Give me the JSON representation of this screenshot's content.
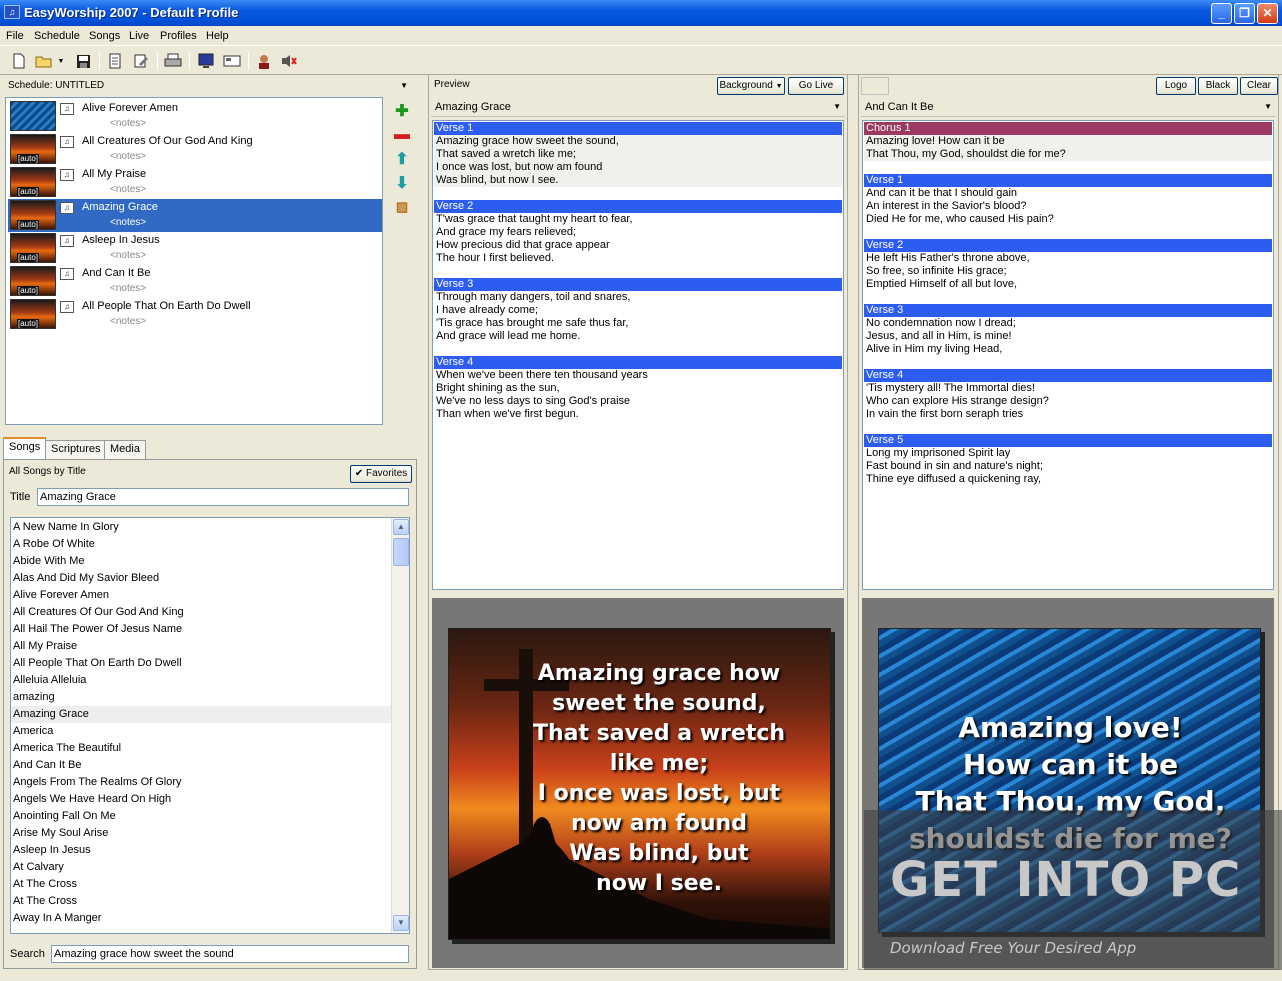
{
  "window": {
    "title": "EasyWorship 2007 - Default Profile",
    "minimize": "_",
    "maximize": "❐",
    "close": "✕"
  },
  "menu": [
    "File",
    "Schedule",
    "Songs",
    "Live",
    "Profiles",
    "Help"
  ],
  "toolbar_icons": [
    "new-icon",
    "open-icon",
    "save-icon",
    "properties-icon",
    "edit-icon",
    "print-icon",
    "monitor-icon",
    "display-icon",
    "user-icon",
    "mute-icon"
  ],
  "schedule": {
    "label": "Schedule: UNTITLED",
    "items": [
      {
        "title": "Alive Forever Amen",
        "notes": "<notes>",
        "thumb": "blue",
        "auto": ""
      },
      {
        "title": "All Creatures Of Our God And King",
        "notes": "<notes>",
        "thumb": "auto",
        "auto": "[auto]"
      },
      {
        "title": "All My Praise",
        "notes": "<notes>",
        "thumb": "auto",
        "auto": "[auto]"
      },
      {
        "title": "Amazing Grace",
        "notes": "<notes>",
        "thumb": "auto",
        "auto": "[auto]",
        "selected": true
      },
      {
        "title": "Asleep In Jesus",
        "notes": "<notes>",
        "thumb": "auto",
        "auto": "[auto]"
      },
      {
        "title": "And Can It Be",
        "notes": "<notes>",
        "thumb": "auto",
        "auto": "[auto]"
      },
      {
        "title": "All People That On Earth Do Dwell",
        "notes": "<notes>",
        "thumb": "auto",
        "auto": "[auto]"
      }
    ]
  },
  "tabs": [
    "Songs",
    "Scriptures",
    "Media"
  ],
  "songs": {
    "header": "All Songs by Title",
    "favorites": "Favorites",
    "title_label": "Title",
    "title_value": "Amazing Grace",
    "list": [
      "A New Name In Glory",
      "A Robe Of White",
      "Abide With Me",
      "Alas And Did My Savior Bleed",
      "Alive Forever Amen",
      "All Creatures Of Our God And King",
      "All Hail The Power Of Jesus Name",
      "All My Praise",
      "All People That On Earth Do Dwell",
      "Alleluia Alleluia",
      "amazing",
      "Amazing Grace",
      "America",
      "America The Beautiful",
      "And Can It Be",
      "Angels From The Realms Of Glory",
      "Angels We Have Heard On High",
      "Anointing Fall On Me",
      "Arise My Soul Arise",
      "Asleep In Jesus",
      "At Calvary",
      "At The Cross",
      "At The Cross",
      "Away In A Manger"
    ],
    "selected_index": 11,
    "search_label": "Search",
    "search_value": "Amazing grace how sweet the sound"
  },
  "preview": {
    "label": "Preview",
    "background_btn": "Background",
    "golive_btn": "Go Live >>>",
    "song": "Amazing Grace",
    "verses": [
      {
        "name": "Verse 1",
        "lines": [
          "Amazing grace how sweet the sound,",
          "That saved a wretch like me;",
          "I once was lost, but now am found",
          "Was blind, but now I see."
        ]
      },
      {
        "name": "Verse 2",
        "lines": [
          "T'was grace that taught my heart to fear,",
          "And grace my fears relieved;",
          "How precious did that grace appear",
          "The hour I first believed."
        ]
      },
      {
        "name": "Verse 3",
        "lines": [
          "Through many dangers, toil and snares,",
          "I have already come;",
          "'Tis grace has brought me safe thus far,",
          "And grace will lead me home."
        ]
      },
      {
        "name": "Verse 4",
        "lines": [
          "When we've been there ten thousand years",
          "Bright shining as the sun,",
          "We've no less days to sing God's praise",
          "Than when we've first begun."
        ]
      }
    ],
    "slide_lines": [
      "Amazing grace how",
      "sweet the sound,",
      "That saved a wretch",
      "like me;",
      "I once was lost, but",
      "now am found",
      "Was blind, but",
      "now I see."
    ]
  },
  "live": {
    "logo_btn": "Logo",
    "black_btn": "Black",
    "clear_btn": "Clear",
    "song": "And Can It Be",
    "verses": [
      {
        "name": "Chorus 1",
        "chorus": true,
        "lines": [
          "Amazing love! How can it be",
          "That Thou, my God, shouldst die for me?"
        ]
      },
      {
        "name": "Verse 1",
        "lines": [
          "And can it be that I should gain",
          "An interest in the Savior's blood?",
          "Died He for me, who caused His pain?"
        ]
      },
      {
        "name": "Verse 2",
        "lines": [
          "He left His Father's throne above,",
          "So free, so infinite His grace;",
          "Emptied Himself of all but love,"
        ]
      },
      {
        "name": "Verse 3",
        "lines": [
          "No condemnation now I dread;",
          "Jesus, and all in Him, is mine!",
          "Alive in Him my living Head,"
        ]
      },
      {
        "name": "Verse 4",
        "lines": [
          "'Tis mystery all! The Immortal dies!",
          "Who can explore His strange design?",
          "In vain the first born seraph tries"
        ]
      },
      {
        "name": "Verse 5",
        "lines": [
          "Long my imprisoned Spirit lay",
          "Fast bound in sin and nature's night;",
          "Thine eye diffused a quickening ray,"
        ]
      }
    ],
    "slide_lines": [
      "Amazing love!",
      "How can it be",
      "That Thou, my God,",
      "shouldst die for me?"
    ]
  },
  "watermark": {
    "brand": "GET INTO PC",
    "tagline": "Download Free Your Desired App"
  },
  "colors": {
    "accent": "#316ac5",
    "verse_header": "#2d5cf0",
    "chorus_header": "#9c3a64"
  }
}
